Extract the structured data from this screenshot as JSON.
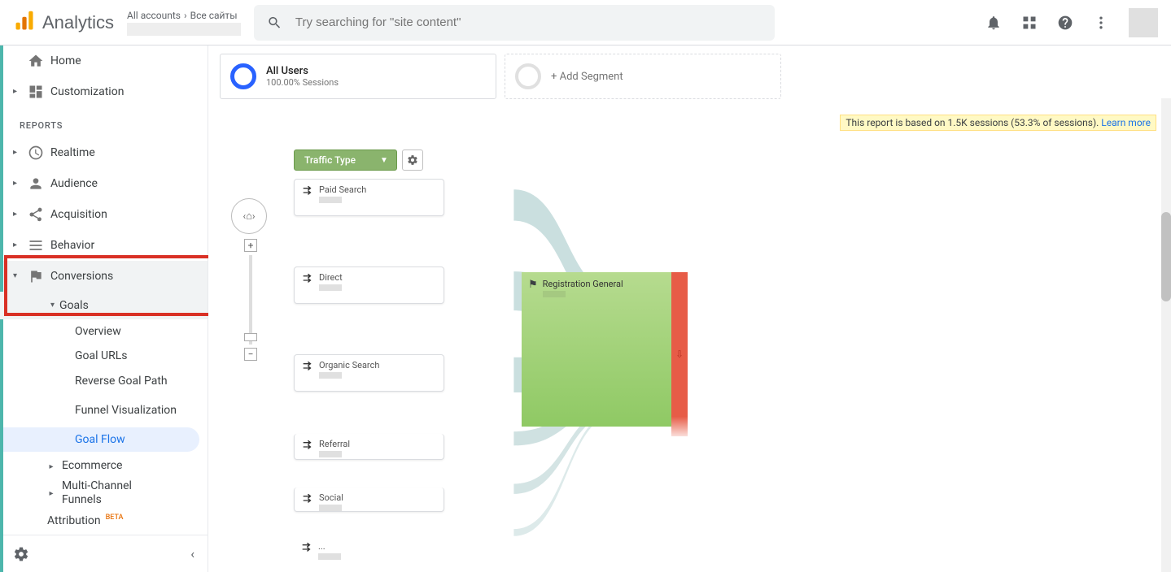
{
  "header": {
    "product": "Analytics",
    "breadcrumb_top_left": "All accounts",
    "breadcrumb_top_right": "Все сайты",
    "search_placeholder": "Try searching for \"site content\""
  },
  "sidebar": {
    "home": "Home",
    "customization": "Customization",
    "reports_header": "REPORTS",
    "realtime": "Realtime",
    "audience": "Audience",
    "acquisition": "Acquisition",
    "behavior": "Behavior",
    "conversions": "Conversions",
    "goals": "Goals",
    "goal_children": {
      "overview": "Overview",
      "goal_urls": "Goal URLs",
      "reverse": "Reverse Goal Path",
      "funnel": "Funnel Visualization",
      "goal_flow": "Goal Flow"
    },
    "ecommerce": "Ecommerce",
    "mcf": "Multi-Channel Funnels",
    "attribution": "Attribution",
    "beta": "BETA"
  },
  "segments": {
    "all_users": "All Users",
    "all_users_sub": "100.00% Sessions",
    "add_segment": "+ Add Segment"
  },
  "notice": {
    "text": "This report is based on 1.5K sessions (53.3% of sessions). ",
    "link": "Learn more"
  },
  "dimension": {
    "label": "Traffic Type"
  },
  "flow_nodes": {
    "paid_search": "Paid Search",
    "direct": "Direct",
    "organic": "Organic Search",
    "referral": "Referral",
    "social": "Social",
    "more": "...",
    "goal": "Registration General"
  },
  "chart_data": {
    "type": "sankey",
    "dimension": "Traffic Type",
    "sources": [
      {
        "name": "Paid Search"
      },
      {
        "name": "Direct"
      },
      {
        "name": "Organic Search"
      },
      {
        "name": "Referral"
      },
      {
        "name": "Social"
      },
      {
        "name": "..."
      }
    ],
    "target": {
      "name": "Registration General"
    },
    "dropoff_indicator": true,
    "sampling_note": "Based on 1.5K sessions (53.3% of sessions)"
  }
}
